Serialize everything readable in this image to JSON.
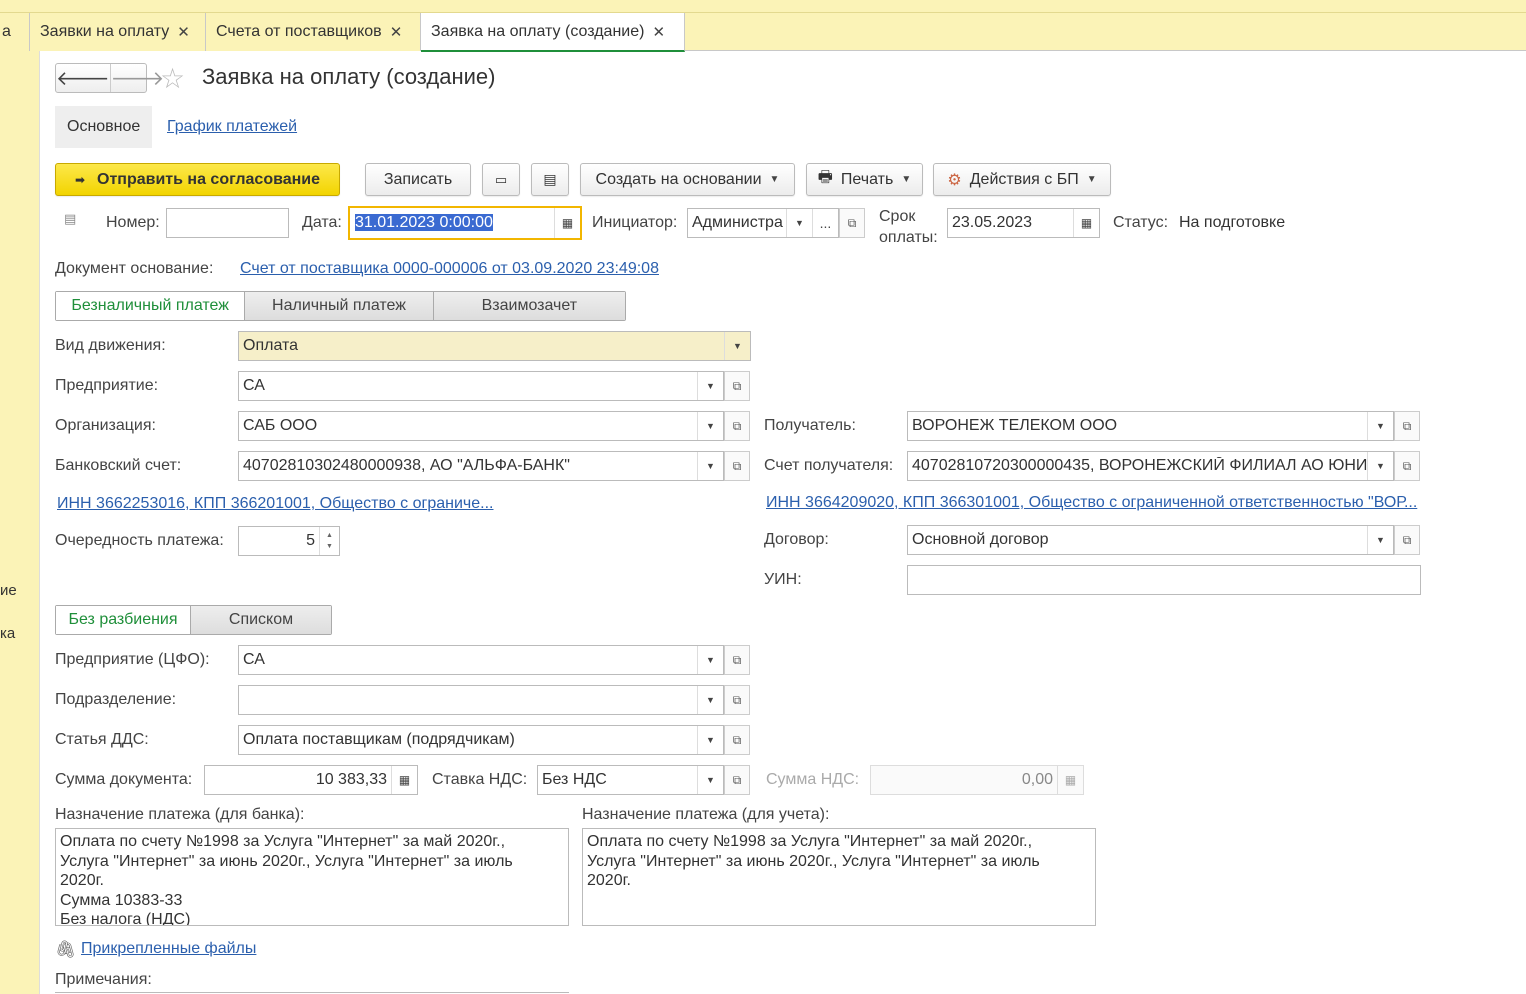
{
  "tabs": [
    {
      "label": "а",
      "closable": false
    },
    {
      "label": "Заявки на оплату",
      "closable": true
    },
    {
      "label": "Счета от поставщиков",
      "closable": true
    },
    {
      "label": "Заявка на оплату (создание)",
      "closable": true,
      "active": true
    }
  ],
  "left_panel": {
    "item1": "ие",
    "item2": "ка"
  },
  "form": {
    "title": "Заявка на оплату (создание)",
    "subtabs": {
      "main": "Основное",
      "schedule": "График платежей"
    },
    "toolbar": {
      "send": "Отправить на согласование",
      "save": "Записать",
      "create_based": "Создать на основании",
      "print": "Печать",
      "bp_actions": "Действия с БП"
    },
    "header": {
      "number_label": "Номер:",
      "number_value": "",
      "date_label": "Дата:",
      "date_value": "31.01.2023  0:00:00",
      "initiator_label": "Инициатор:",
      "initiator_value": "Администра",
      "initiator_more": "...",
      "due_label_1": "Срок",
      "due_label_2": "оплаты:",
      "due_value": "23.05.2023",
      "status_label": "Статус:",
      "status_value": "На подготовке"
    },
    "basis": {
      "label": "Документ основание:",
      "value": "Счет от поставщика 0000-000006 от 03.09.2020 23:49:08"
    },
    "payment_type_tabs": [
      "Безналичный платеж",
      "Наличный платеж",
      "Взаимозачет"
    ],
    "fields": {
      "movement_label": "Вид движения:",
      "movement_value": "Оплата",
      "enterprise_label": "Предприятие:",
      "enterprise_value": "СА",
      "org_label": "Организация:",
      "org_value": "САБ ООО",
      "bank_label": "Банковский счет:",
      "bank_value": "40702810302480000938, АО \"АЛЬФА-БАНК\"",
      "org_inn": "ИНН 3662253016, КПП 366201001, Общество с ограниче...",
      "priority_label": "Очередность платежа:",
      "priority_value": "5",
      "recipient_label": "Получатель:",
      "recipient_value": "ВОРОНЕЖ ТЕЛЕКОМ ООО",
      "recipient_account_label": "Счет получателя:",
      "recipient_account_value": "40702810720300000435, ВОРОНЕЖСКИЙ ФИЛИАЛ АО ЮНИ",
      "recipient_inn": "ИНН 3664209020, КПП 366301001, Общество с ограниченной ответственностью \"ВОР...",
      "contract_label": "Договор:",
      "contract_value": "Основной договор",
      "uin_label": "УИН:",
      "uin_value": ""
    },
    "split_tabs": [
      "Без разбиения",
      "Списком"
    ],
    "split": {
      "cfo_label": "Предприятие (ЦФО):",
      "cfo_value": "СА",
      "dept_label": "Подразделение:",
      "dept_value": "",
      "dds_label": "Статья ДДС:",
      "dds_value": "Оплата поставщикам (подрядчикам)"
    },
    "amounts": {
      "sum_label": "Сумма документа:",
      "sum_value": "10 383,33",
      "vat_rate_label": "Ставка НДС:",
      "vat_rate_value": "Без НДС",
      "vat_sum_label": "Сумма НДС:",
      "vat_sum_value": "0,00"
    },
    "purpose_bank_label": "Назначение платежа (для банка):",
    "purpose_bank_value": "Оплата по счету №1998 за Услуга \"Интернет\" за май 2020г.,\nУслуга \"Интернет\" за июнь 2020г., Услуга \"Интернет\" за июль\n2020г.\nСумма 10383-33\nБез налога (НДС)",
    "purpose_acc_label": "Назначение платежа (для учета):",
    "purpose_acc_value": "Оплата по счету №1998 за Услуга \"Интернет\" за май 2020г.,\nУслуга \"Интернет\" за июнь 2020г., Услуга \"Интернет\" за июль\n2020г.",
    "attached_files": "Прикрепленные файлы",
    "notes_label": "Примечания:"
  },
  "colors": {
    "accent": "#f2d400",
    "active_tab": "#1f8f3a",
    "link": "#2b5fad",
    "panel_bg": "#fbf3b7"
  }
}
